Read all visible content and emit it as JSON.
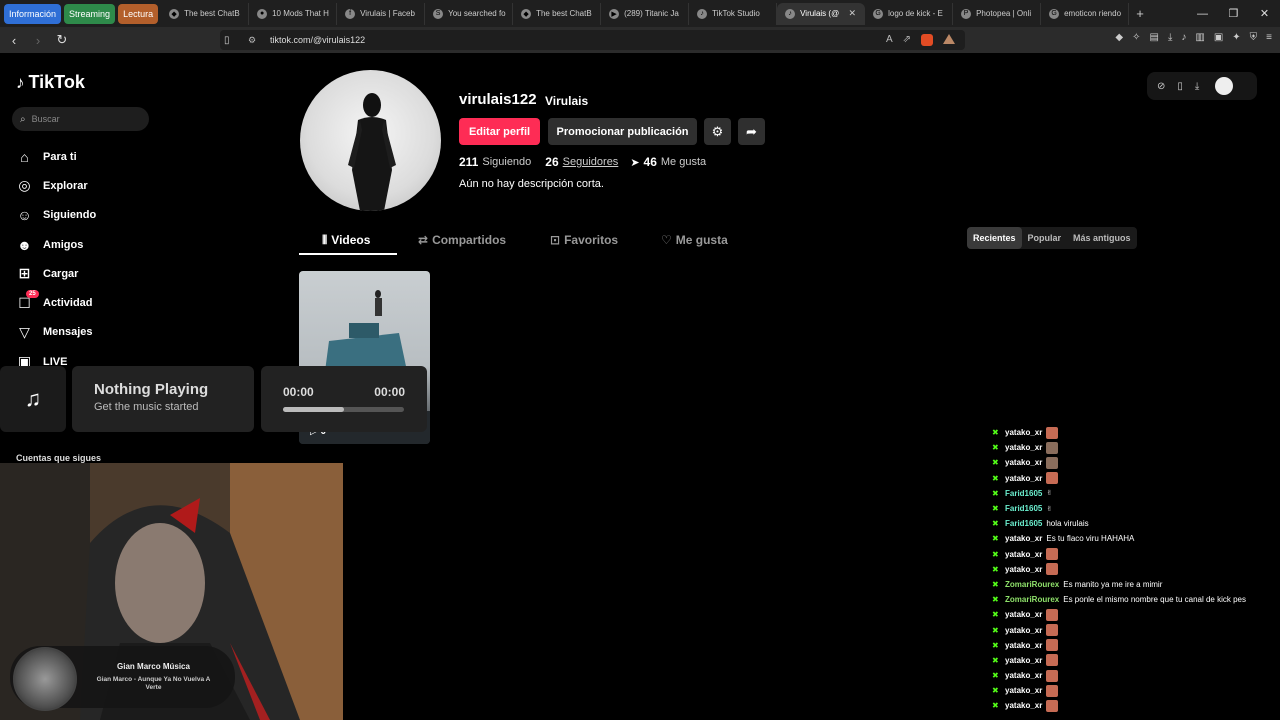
{
  "browser": {
    "groups": [
      {
        "label": "Información",
        "color": "#2f6fd6"
      },
      {
        "label": "Streaming",
        "color": "#2e8a4a"
      },
      {
        "label": "Lectura",
        "color": "#b35f2b"
      }
    ],
    "tabs": [
      {
        "title": "The best ChatB",
        "icon": "◆"
      },
      {
        "title": "10 Mods That H",
        "icon": "●"
      },
      {
        "title": "Virulais | Faceb",
        "icon": "f"
      },
      {
        "title": "You searched fo",
        "icon": "S"
      },
      {
        "title": "The best ChatB",
        "icon": "◆"
      },
      {
        "title": "(289) Titanic Ja",
        "icon": "▶"
      },
      {
        "title": "TikTok Studio",
        "icon": "♪"
      },
      {
        "title": "Virulais (@",
        "icon": "♪",
        "active": true
      },
      {
        "title": "logo de kick - E",
        "icon": "G"
      },
      {
        "title": "Photopea | Onli",
        "icon": "P"
      },
      {
        "title": "emoticon riendo",
        "icon": "G"
      }
    ],
    "url": "tiktok.com/@virulais122"
  },
  "sidebar": {
    "logo": "TikTok",
    "search_placeholder": "Buscar",
    "items": [
      {
        "label": "Para ti",
        "icon": "⌂"
      },
      {
        "label": "Explorar",
        "icon": "◎"
      },
      {
        "label": "Siguiendo",
        "icon": "☺"
      },
      {
        "label": "Amigos",
        "icon": "☻"
      },
      {
        "label": "Cargar",
        "icon": "⊞"
      },
      {
        "label": "Actividad",
        "icon": "☐",
        "badge": "25"
      },
      {
        "label": "Mensajes",
        "icon": "▽"
      },
      {
        "label": "LIVE",
        "icon": "▣"
      }
    ],
    "following_title": "Cuentas que sigues"
  },
  "profile": {
    "username": "virulais122",
    "nickname": "Virulais",
    "edit_label": "Editar perfil",
    "promo_label": "Promocionar publicación",
    "following_count": "211",
    "following_label": "Siguiendo",
    "followers_count": "26",
    "followers_label": "Seguidores",
    "likes_count": "46",
    "likes_label": "Me gusta",
    "bio": "Aún no hay descripción corta.",
    "tabs": [
      "Videos",
      "Compartidos",
      "Favoritos",
      "Me gusta"
    ],
    "sorts": [
      "Recientes",
      "Popular",
      "Más antiguos"
    ],
    "video_views": "0"
  },
  "music_widget": {
    "title": "Nothing Playing",
    "subtitle": "Get the music started",
    "time_current": "00:00",
    "time_total": "00:00",
    "progress": 0.5
  },
  "now_playing": {
    "artist": "Gian Marco Música",
    "song": "Gian Marco - Aunque Ya No Vuelva A Verte"
  },
  "chat": [
    {
      "user": "yatako_xr",
      "text": "",
      "emote": "e"
    },
    {
      "user": "yatako_xr",
      "text": "",
      "emote": "b"
    },
    {
      "user": "yatako_xr",
      "text": "",
      "emote": "b"
    },
    {
      "user": "yatako_xr",
      "text": "",
      "emote": "e"
    },
    {
      "user": "Farid1605",
      "text": "",
      "emote": "s"
    },
    {
      "user": "Farid1605",
      "text": "",
      "emote": "s"
    },
    {
      "user": "Farid1605",
      "text": "hola virulais",
      "emote": ""
    },
    {
      "user": "yatako_xr",
      "text": "Es tu flaco viru HAHAHA",
      "emote": ""
    },
    {
      "user": "yatako_xr",
      "text": "",
      "emote": "e"
    },
    {
      "user": "yatako_xr",
      "text": "",
      "emote": "e"
    },
    {
      "user": "ZomariRourex",
      "text": "Es manito ya me ire a mimir",
      "emote": "",
      "green": true
    },
    {
      "user": "ZomariRourex",
      "text": "Es ponle el mismo nombre que tu canal de kick pes",
      "emote": "",
      "green": true
    },
    {
      "user": "yatako_xr",
      "text": "",
      "emote": "e"
    },
    {
      "user": "yatako_xr",
      "text": "",
      "emote": "e"
    },
    {
      "user": "yatako_xr",
      "text": "",
      "emote": "e"
    },
    {
      "user": "yatako_xr",
      "text": "",
      "emote": "e"
    },
    {
      "user": "yatako_xr",
      "text": "",
      "emote": "e"
    },
    {
      "user": "yatako_xr",
      "text": "",
      "emote": "e"
    },
    {
      "user": "yatako_xr",
      "text": "",
      "emote": "e"
    }
  ],
  "colors": {
    "accent": "#fe2c55",
    "kick": "#53fc18"
  }
}
